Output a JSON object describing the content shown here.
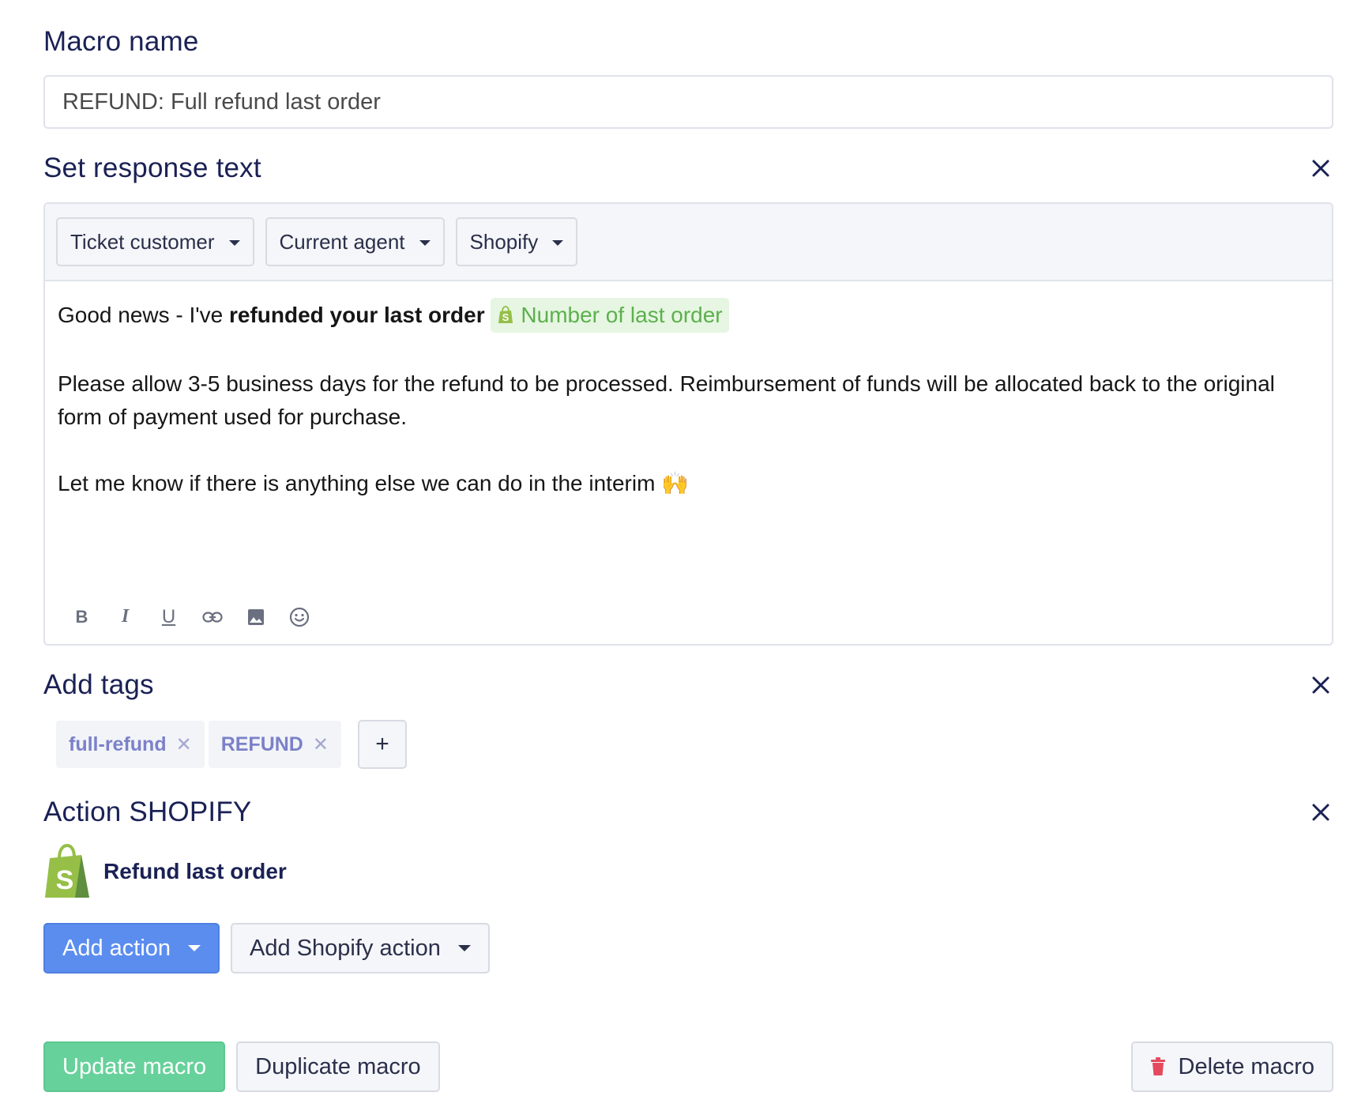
{
  "macro": {
    "name_label": "Macro name",
    "name_value": "REFUND: Full refund last order"
  },
  "response": {
    "title": "Set response text",
    "variables": [
      {
        "label": "Ticket customer"
      },
      {
        "label": "Current agent"
      },
      {
        "label": "Shopify"
      }
    ],
    "line1_plain": "Good news - I've ",
    "line1_bold": "refunded your last order",
    "chip_label": "Number of last order",
    "paragraph2": "Please allow 3-5 business days for the refund to be processed. Reimbursement of funds will be allocated back to the original form of payment used for purchase.",
    "paragraph3": "Let me know if there is anything else we can do in the interim 🙌",
    "format_tools": [
      "bold",
      "italic",
      "underline",
      "link",
      "image",
      "emoji"
    ]
  },
  "tags": {
    "title": "Add tags",
    "items": [
      {
        "label": "full-refund"
      },
      {
        "label": "REFUND"
      }
    ],
    "add_label": "+"
  },
  "action": {
    "title": "Action SHOPIFY",
    "item_label": "Refund last order",
    "add_action_label": "Add action",
    "add_shopify_label": "Add Shopify action"
  },
  "footer": {
    "update_label": "Update macro",
    "duplicate_label": "Duplicate macro",
    "delete_label": "Delete macro"
  },
  "colors": {
    "title": "#1a2155",
    "primary": "#5b8def",
    "success": "#67d19b",
    "shopify_green": "#95bf47",
    "danger": "#e5495e",
    "tag_text": "#7b81c8"
  }
}
